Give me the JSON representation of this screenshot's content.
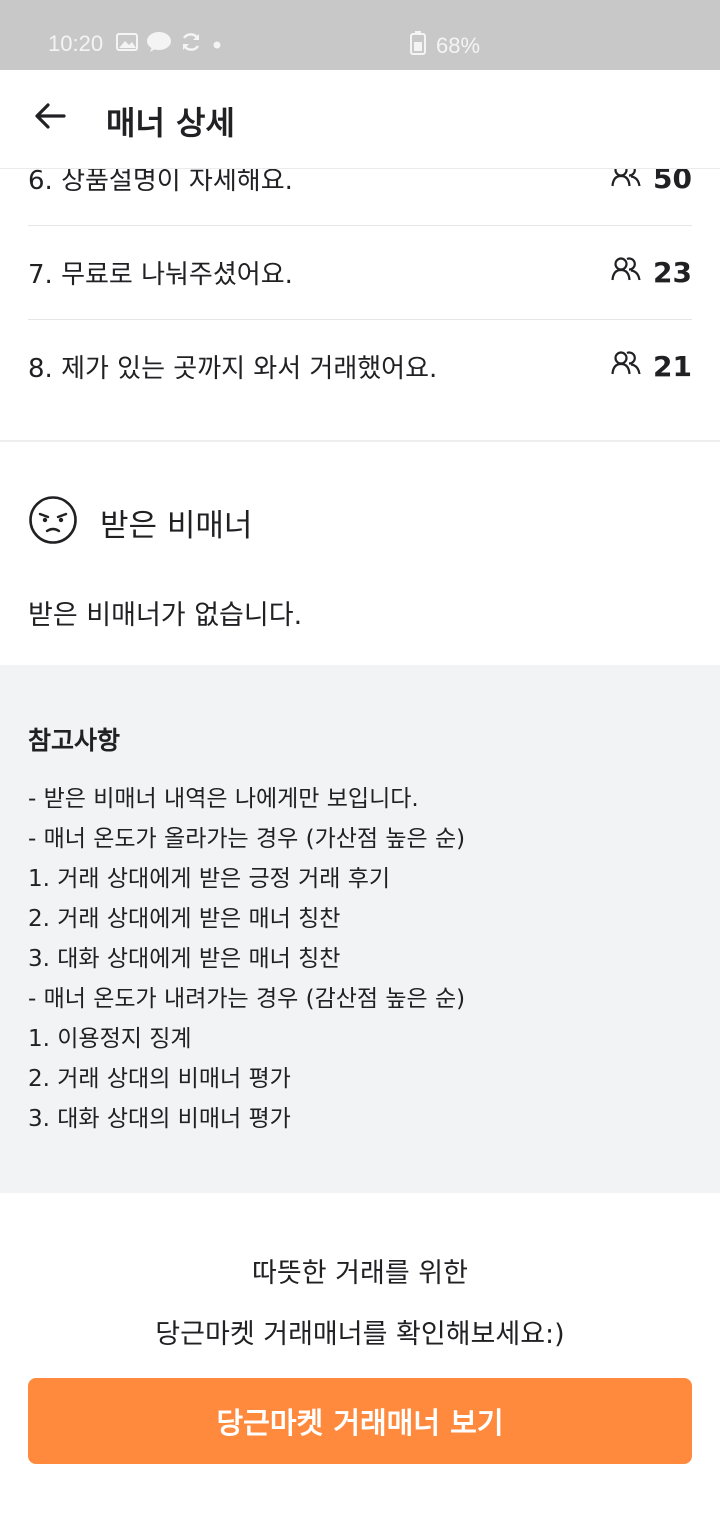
{
  "status_bar": {
    "time": "10:20",
    "battery": "68%"
  },
  "app_bar": {
    "title": "매너 상세"
  },
  "manner_items": [
    {
      "label": "6. 상품설명이 자세해요.",
      "count": "50"
    },
    {
      "label": "7. 무료로 나눠주셨어요.",
      "count": "23"
    },
    {
      "label": "8. 제가 있는 곳까지 와서 거래했어요.",
      "count": "21"
    }
  ],
  "bad_manner": {
    "title": "받은 비매너",
    "empty": "받은 비매너가 없습니다."
  },
  "notes": {
    "title": "참고사항",
    "lines": [
      "- 받은 비매너 내역은 나에게만 보입니다.",
      "- 매너 온도가 올라가는 경우 (가산점 높은 순)",
      "1. 거래 상대에게 받은 긍정 거래 후기",
      "2. 거래 상대에게 받은 매너 칭찬",
      "3. 대화 상대에게 받은 매너 칭찬",
      "- 매너 온도가 내려가는 경우 (감산점 높은 순)",
      "1. 이용정지 징계",
      "2. 거래 상대의 비매너 평가",
      "3. 대화 상대의 비매너 평가"
    ]
  },
  "cta": {
    "line1": "따뜻한 거래를 위한",
    "line2": "당근마켓 거래매너를 확인해보세요:)",
    "button": "당근마켓 거래매너 보기"
  },
  "icons": {
    "back": "arrow-left-icon",
    "people": "people-icon",
    "frown": "annoyed-face-icon"
  },
  "colors": {
    "accent": "#ff8a3d",
    "notes_bg": "#f2f3f5",
    "status_bar": "#c8c8c8"
  }
}
